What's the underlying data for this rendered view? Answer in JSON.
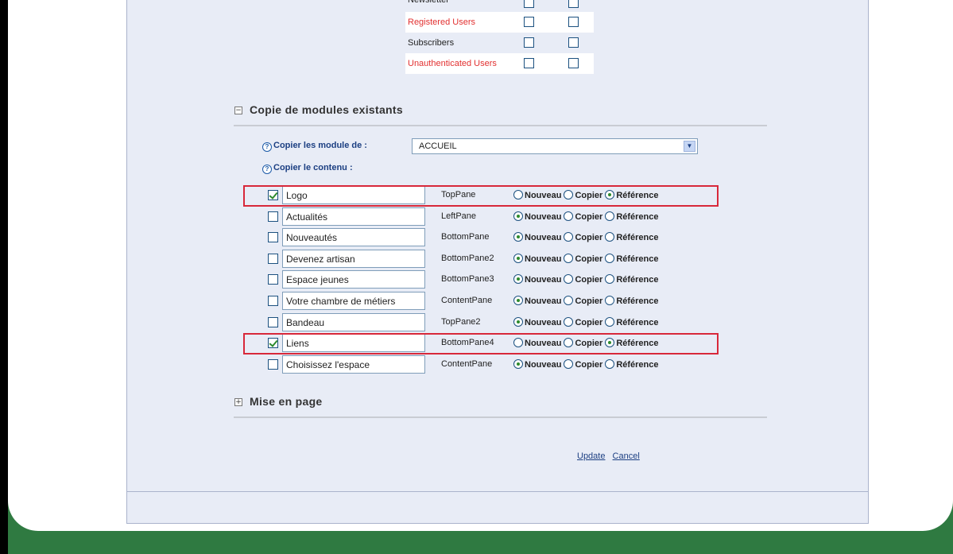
{
  "roles": [
    {
      "label": "Newsletter",
      "red": false,
      "cut": true
    },
    {
      "label": "Registered Users",
      "red": true,
      "cut": false
    },
    {
      "label": "Subscribers",
      "red": false,
      "cut": false
    },
    {
      "label": "Unauthenticated Users",
      "red": true,
      "cut": false
    }
  ],
  "copy_section": {
    "title": "Copie de modules existants",
    "toggle": "−",
    "copy_from_label": "Copier les module de :",
    "copy_from_value": "ACCUEIL",
    "copy_content_label": "Copier le contenu :"
  },
  "radio_labels": {
    "new": "Nouveau",
    "copy": "Copier",
    "ref": "Référence"
  },
  "modules": [
    {
      "name": "Logo",
      "pane": "TopPane",
      "checked": true,
      "mode": "ref"
    },
    {
      "name": "Actualités",
      "pane": "LeftPane",
      "checked": false,
      "mode": "new"
    },
    {
      "name": "Nouveautés",
      "pane": "BottomPane",
      "checked": false,
      "mode": "new"
    },
    {
      "name": "Devenez artisan",
      "pane": "BottomPane2",
      "checked": false,
      "mode": "new"
    },
    {
      "name": "Espace jeunes",
      "pane": "BottomPane3",
      "checked": false,
      "mode": "new"
    },
    {
      "name": "Votre chambre de métiers",
      "pane": "ContentPane",
      "checked": false,
      "mode": "new"
    },
    {
      "name": "Bandeau",
      "pane": "TopPane2",
      "checked": false,
      "mode": "new"
    },
    {
      "name": "Liens",
      "pane": "BottomPane4",
      "checked": true,
      "mode": "ref"
    },
    {
      "name": "Choisissez l'espace",
      "pane": "ContentPane",
      "checked": false,
      "mode": "new"
    }
  ],
  "layout_section": {
    "title": "Mise en page",
    "toggle": "+"
  },
  "actions": {
    "update": "Update",
    "cancel": "Cancel"
  },
  "colors": {
    "highlight": "#d8283a",
    "background_green": "#2f7a41",
    "link_blue": "#1c3f82"
  }
}
